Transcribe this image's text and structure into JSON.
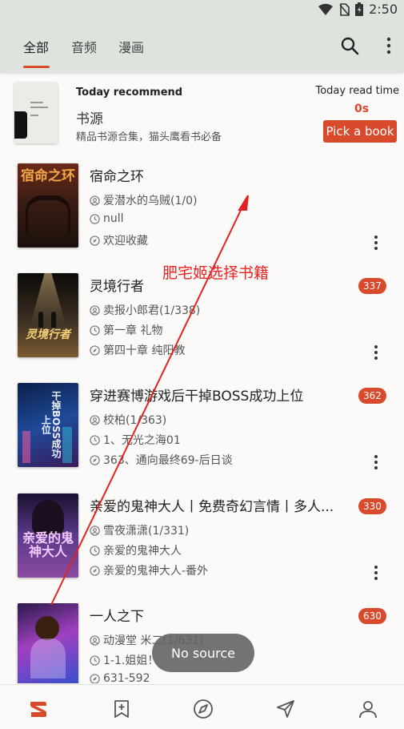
{
  "status_bar": {
    "time": "2:50"
  },
  "tabs": [
    "全部",
    "音频",
    "漫画"
  ],
  "active_tab": 0,
  "recommend": {
    "title": "Today recommend",
    "source_name": "书源",
    "description": "精品书源合集，猫头鹰看书必备",
    "read_time_label": "Today read time",
    "read_time_value": "0s",
    "pick_button": "Pick a book"
  },
  "books": [
    {
      "title": "宿命之环",
      "author": "爱潜水的乌贼(1/0)",
      "latest": "null",
      "last_read": "欢迎收藏",
      "badge": "",
      "cover_text": "宿命之环",
      "cover_bg": "#3a1d14"
    },
    {
      "title": "灵境行者",
      "author": "卖报小郎君(1/338)",
      "latest": "第一章 礼物",
      "last_read": "第四十章 纯阳教",
      "badge": "337",
      "cover_text": "灵境行者",
      "cover_bg": "#2a2420"
    },
    {
      "title": "穿进赛博游戏后干掉BOSS成功上位",
      "author": "校柏(1/363)",
      "latest": "1、无光之海01",
      "last_read": "363、通向最终69-后日谈",
      "badge": "362",
      "cover_text": "干掉BOSS成功上位",
      "cover_bg": "#15295a"
    },
    {
      "title": "亲爱的鬼神大人丨免费奇幻言情丨多人...",
      "author": "雪夜潇潇(1/331)",
      "latest": "亲爱的鬼神大人",
      "last_read": "亲爱的鬼神大人-番外",
      "badge": "330",
      "cover_text": "亲爱的鬼神大人",
      "cover_bg": "#3a2a5a"
    },
    {
      "title": "一人之下",
      "author": "动漫堂 米二(1/631)",
      "latest": "1-1.姐姐！",
      "last_read": "631-592",
      "badge": "630",
      "cover_text": "",
      "cover_bg": "#2a1a4a"
    }
  ],
  "annotation": {
    "text": "肥宅姬选择书籍",
    "color": "#e22222"
  },
  "toast": {
    "text": "No source"
  },
  "bottom_nav": [
    "bookshelf-icon",
    "add-book-icon",
    "explore-icon",
    "send-icon",
    "profile-icon"
  ],
  "colors": {
    "accent": "#d84a2c",
    "appbar": "#dde4dd"
  }
}
